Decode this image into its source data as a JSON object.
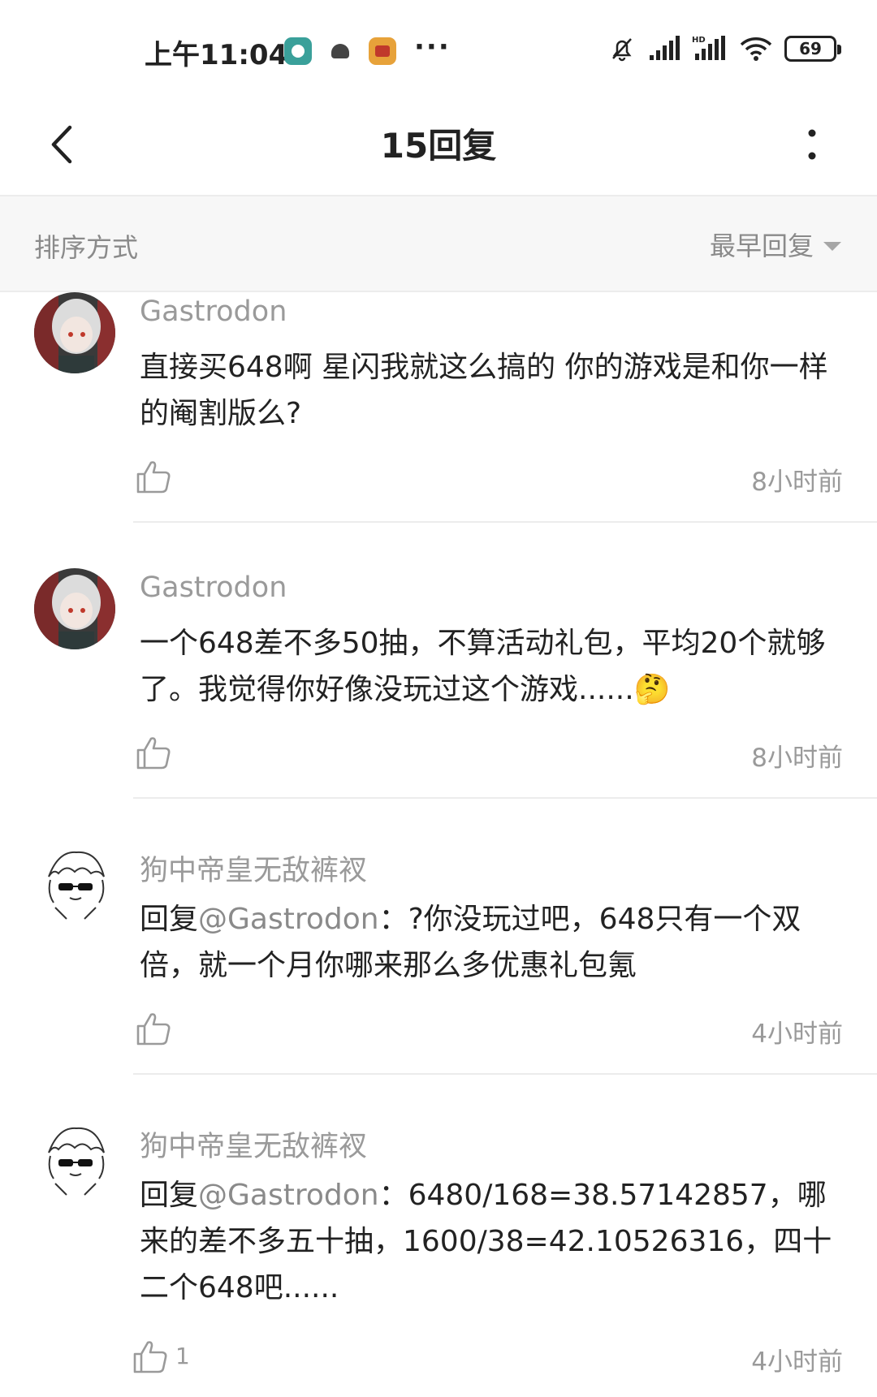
{
  "status_bar": {
    "time": "上午11:04",
    "more": "···",
    "battery": "69"
  },
  "header": {
    "title": "15回复"
  },
  "sort": {
    "label": "排序方式",
    "selected": "最早回复"
  },
  "comments": [
    {
      "author": "Gastrodon",
      "text": "直接买648啊 星闪我就这么搞的 你的游戏是和你一样的阉割版么?",
      "time": "8小时前"
    },
    {
      "author": "Gastrodon",
      "text": "一个648差不多50抽，不算活动礼包，平均20个就够了。我觉得你好像没玩过这个游戏......",
      "emoji": "🤔",
      "time": "8小时前"
    },
    {
      "author": "狗中帝皇无敌裤衩",
      "reply_prefix": "回复",
      "mention": "@Gastrodon",
      "text": "：?你没玩过吧，648只有一个双倍，就一个月你哪来那么多优惠礼包氪",
      "time": "4小时前"
    },
    {
      "author": "狗中帝皇无敌裤衩",
      "reply_prefix": "回复",
      "mention": "@Gastrodon",
      "text": "：6480/168=38.57142857，哪来的差不多五十抽，1600/38=42.10526316，四十二个648吧......",
      "like_count": "1",
      "time": "4小时前"
    }
  ]
}
